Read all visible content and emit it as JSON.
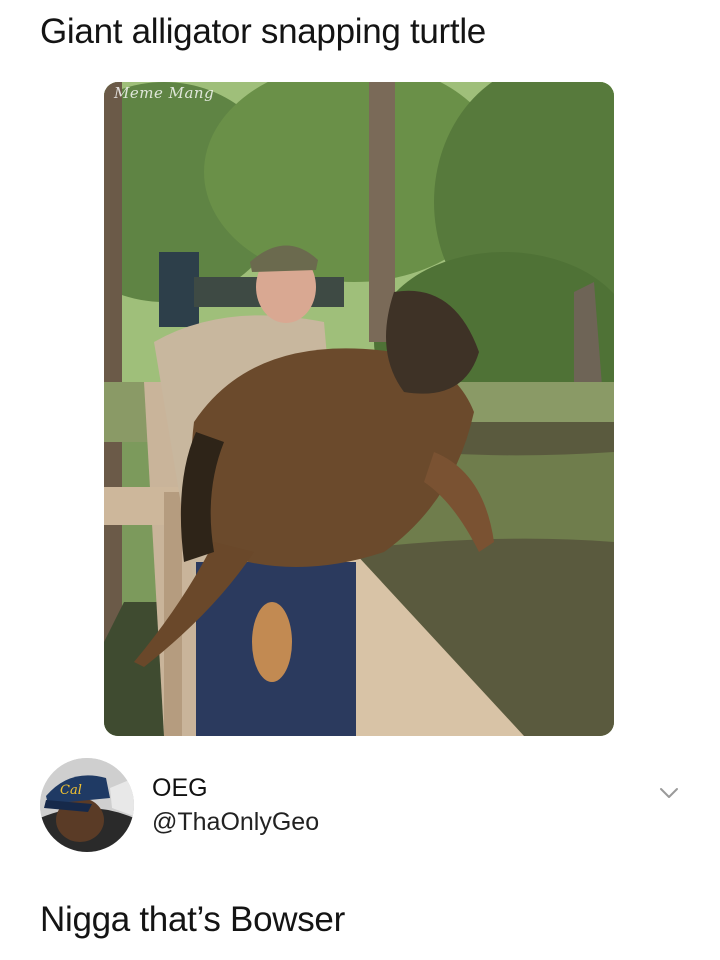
{
  "post": {
    "quoted_text": "Giant alligator snapping turtle",
    "watermark": "Meme Mang",
    "tweet_text": "Nigga that’s Bowser"
  },
  "author": {
    "display_name": "OEG",
    "handle": "@ThaOnlyGeo",
    "cap_text": "Cal"
  },
  "icons": {
    "more": "chevron-down-icon"
  },
  "colors": {
    "text": "#141414",
    "chevron": "#9a9a9a",
    "background": "#ffffff"
  }
}
